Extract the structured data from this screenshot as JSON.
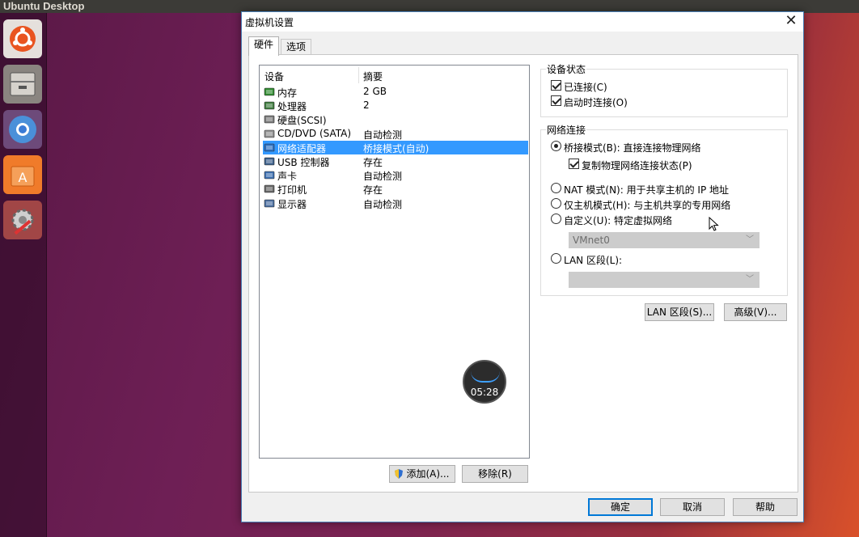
{
  "desktop": {
    "topbar_title": "Ubuntu Desktop"
  },
  "launcher": {
    "items": [
      {
        "name": "ubuntu-icon"
      },
      {
        "name": "files-icon"
      },
      {
        "name": "chromium-icon"
      },
      {
        "name": "software-center-icon"
      },
      {
        "name": "settings-icon"
      }
    ]
  },
  "dialog": {
    "title": "虚拟机设置",
    "close_glyph": "✕",
    "tabs": {
      "hardware": "硬件",
      "options": "选项"
    },
    "device_list": {
      "col_device": "设备",
      "col_summary": "摘要",
      "rows": [
        {
          "name": "内存",
          "summary": "2 GB",
          "icon": "memory-icon",
          "color": "#2f8a2f"
        },
        {
          "name": "处理器",
          "summary": "2",
          "icon": "processor-icon",
          "color": "#3d7a3d"
        },
        {
          "name": "硬盘(SCSI)",
          "summary": "",
          "icon": "hard-disk-icon",
          "color": "#7a7a7a"
        },
        {
          "name": "CD/DVD (SATA)",
          "summary": "自动检测",
          "icon": "cd-dvd-icon",
          "color": "#8f8f8f"
        },
        {
          "name": "网络适配器",
          "summary": "桥接模式(自动)",
          "icon": "network-adapter-icon",
          "color": "#2a6fc2"
        },
        {
          "name": "USB 控制器",
          "summary": "存在",
          "icon": "usb-controller-icon",
          "color": "#3b5f8a"
        },
        {
          "name": "声卡",
          "summary": "自动检测",
          "icon": "sound-card-icon",
          "color": "#3c6fb0"
        },
        {
          "name": "打印机",
          "summary": "存在",
          "icon": "printer-icon",
          "color": "#666666"
        },
        {
          "name": "显示器",
          "summary": "自动检测",
          "icon": "display-icon",
          "color": "#4a6ea0"
        }
      ],
      "selected_index": 4
    },
    "add_button": "添加(A)...",
    "remove_button": "移除(R)",
    "device_status": {
      "title": "设备状态",
      "connected": "已连接(C)",
      "connect_at_power_on": "启动时连接(O)"
    },
    "network_connection": {
      "title": "网络连接",
      "bridged": "桥接模式(B): 直接连接物理网络",
      "replicate_state": "复制物理网络连接状态(P)",
      "nat": "NAT 模式(N): 用于共享主机的 IP 地址",
      "host_only": "仅主机模式(H): 与主机共享的专用网络",
      "custom": "自定义(U): 特定虚拟网络",
      "custom_combo_value": "VMnet0",
      "lan_segment": "LAN 区段(L):",
      "lan_combo_value": ""
    },
    "lan_segments_button": "LAN 区段(S)...",
    "advanced_button": "高级(V)...",
    "ok_button": "确定",
    "cancel_button": "取消",
    "help_button": "帮助"
  },
  "clock_overlay": {
    "time": "05:28"
  },
  "colors": {
    "selection": "#3399ff",
    "dialog_border": "#4a7fb5",
    "default_button_border": "#0078d7"
  }
}
